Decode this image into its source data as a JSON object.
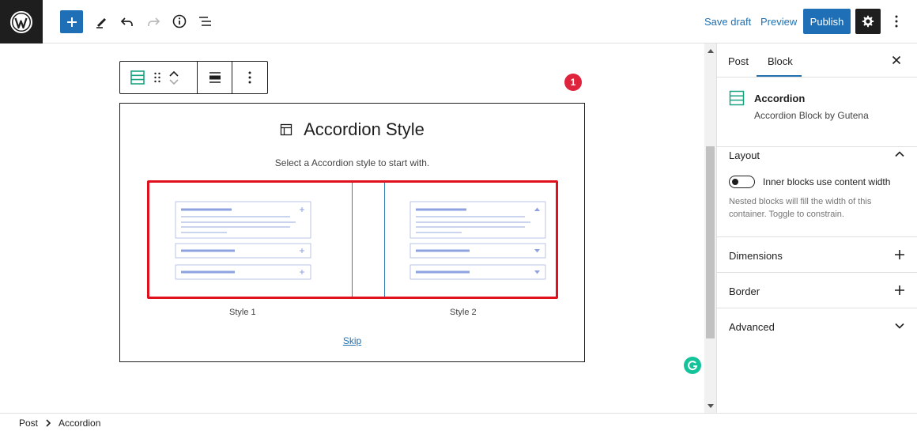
{
  "topbar": {
    "save_draft": "Save draft",
    "preview": "Preview",
    "publish": "Publish",
    "icons": [
      "wordpress-logo",
      "plus-icon",
      "pencil-icon",
      "undo-icon",
      "redo-icon",
      "info-icon",
      "list-view-icon",
      "gear-icon",
      "kebab-icon"
    ]
  },
  "canvas": {
    "notification_count": "1",
    "accordion": {
      "title": "Accordion Style",
      "subtitle": "Select a Accordion style to start with.",
      "styles": [
        {
          "label": "Style 1"
        },
        {
          "label": "Style 2"
        }
      ],
      "skip": "Skip"
    }
  },
  "sidebar": {
    "tabs": [
      {
        "label": "Post"
      },
      {
        "label": "Block"
      }
    ],
    "active_tab": "Block",
    "block": {
      "name": "Accordion",
      "description": "Accordion Block by Gutena"
    },
    "layout": {
      "title": "Layout",
      "toggle_label": "Inner blocks use content width",
      "help": "Nested blocks will fill the width of this container. Toggle to constrain."
    },
    "sections": [
      {
        "title": "Dimensions"
      },
      {
        "title": "Border"
      },
      {
        "title": "Advanced"
      }
    ]
  },
  "breadcrumb": {
    "items": [
      "Post",
      "Accordion"
    ]
  },
  "colors": {
    "accent": "#1e6fb5",
    "badge": "#e0233d",
    "highlight": "#e0101c",
    "block_icon": "#1aa380",
    "grammarly": "#15c39a"
  }
}
